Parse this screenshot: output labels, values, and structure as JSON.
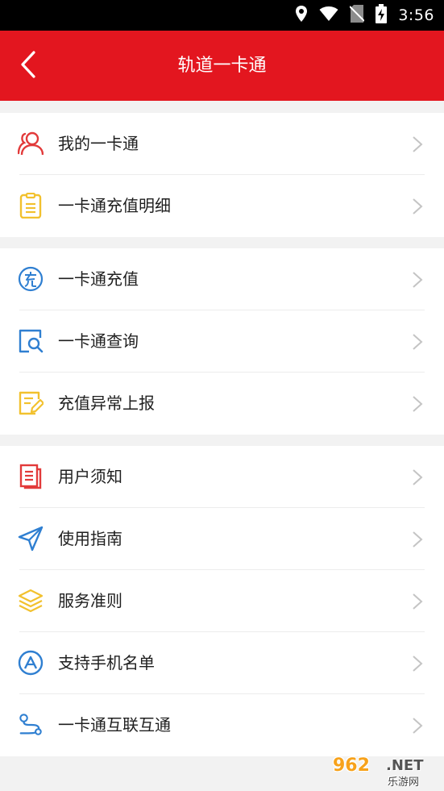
{
  "status_bar": {
    "time": "3:56",
    "icons": [
      "location-icon",
      "wifi-icon",
      "no-sim-icon",
      "battery-charging-icon"
    ]
  },
  "header": {
    "title": "轨道一卡通",
    "back_icon": "chevron-left-icon"
  },
  "groups": [
    {
      "items": [
        {
          "label": "我的一卡通",
          "icon": "users-icon"
        },
        {
          "label": "一卡通充值明细",
          "icon": "clipboard-icon"
        }
      ]
    },
    {
      "items": [
        {
          "label": "一卡通充值",
          "icon": "recharge-icon"
        },
        {
          "label": "一卡通查询",
          "icon": "search-doc-icon"
        },
        {
          "label": "充值异常上报",
          "icon": "edit-report-icon"
        }
      ]
    },
    {
      "items": [
        {
          "label": "用户须知",
          "icon": "document-icon"
        },
        {
          "label": "使用指南",
          "icon": "navigation-icon"
        },
        {
          "label": "服务准则",
          "icon": "layers-icon"
        },
        {
          "label": "支持手机名单",
          "icon": "triangle-circle-icon"
        },
        {
          "label": "一卡通互联互通",
          "icon": "route-icon"
        }
      ]
    }
  ],
  "watermark": {
    "brand": "962",
    "suffix": ".NET",
    "sub": "乐游网"
  },
  "colors": {
    "header_red": "#e3161f",
    "icon_red": "#e23a3a",
    "icon_yellow": "#f2c12e",
    "icon_blue": "#2f7fd1"
  }
}
